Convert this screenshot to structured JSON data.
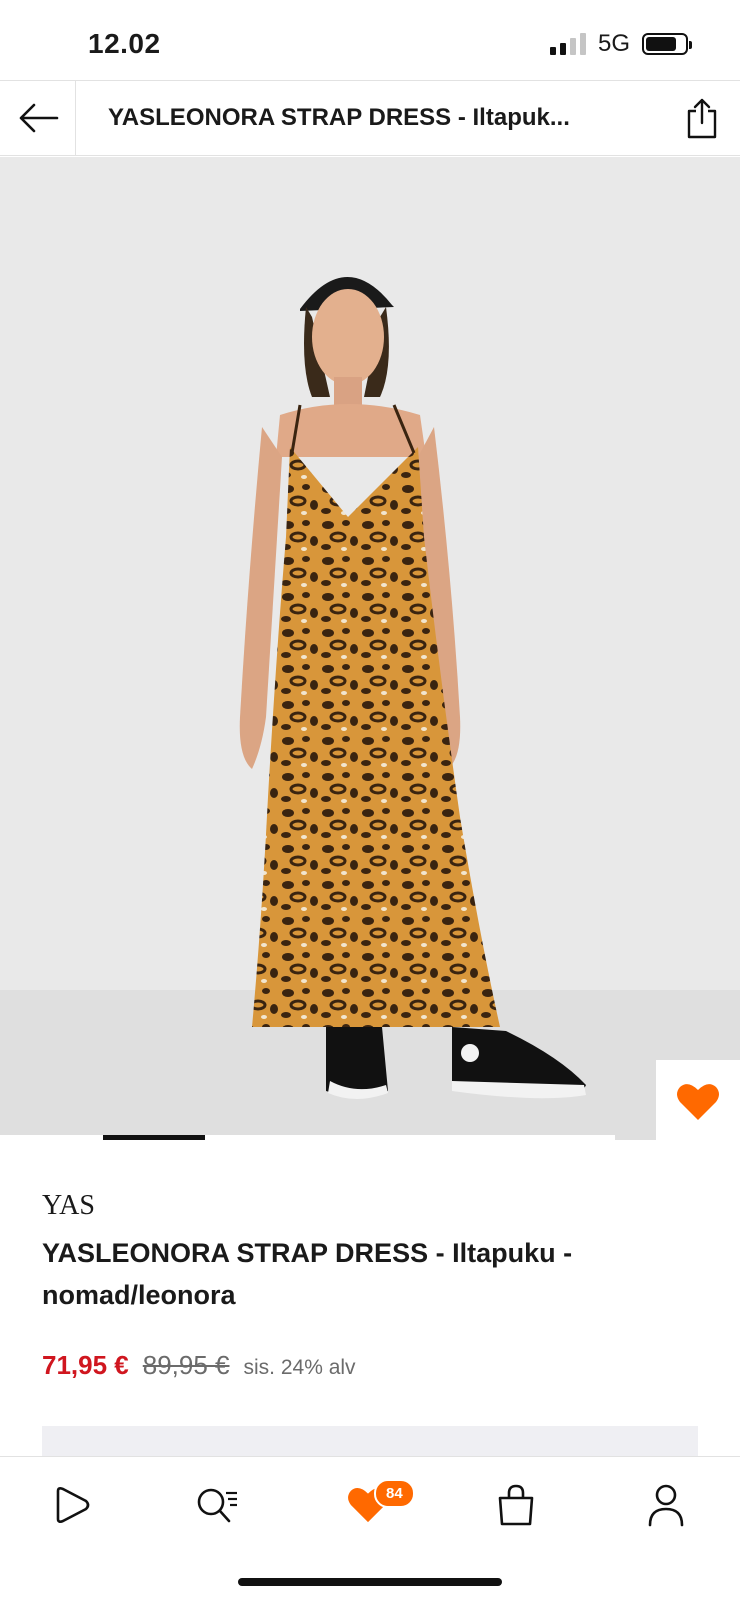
{
  "status_bar": {
    "time": "12.02",
    "network": "5G"
  },
  "header": {
    "title": "YASLEONORA STRAP DRESS  - Iltapuk..."
  },
  "product": {
    "brand": "YAS",
    "name": "YASLEONORA STRAP DRESS  - Iltapuku - nomad/leonora",
    "price_current": "71,95 €",
    "price_original": "89,95 €",
    "vat_note": "sis. 24% alv"
  },
  "gallery": {
    "image_index": 1
  },
  "bottom_nav": {
    "wishlist_count": "84",
    "items": [
      "home-icon",
      "search-icon",
      "wishlist-heart-icon",
      "bag-icon",
      "profile-icon"
    ]
  },
  "colors": {
    "accent": "#ff6900",
    "price_sale": "#d0161f"
  }
}
